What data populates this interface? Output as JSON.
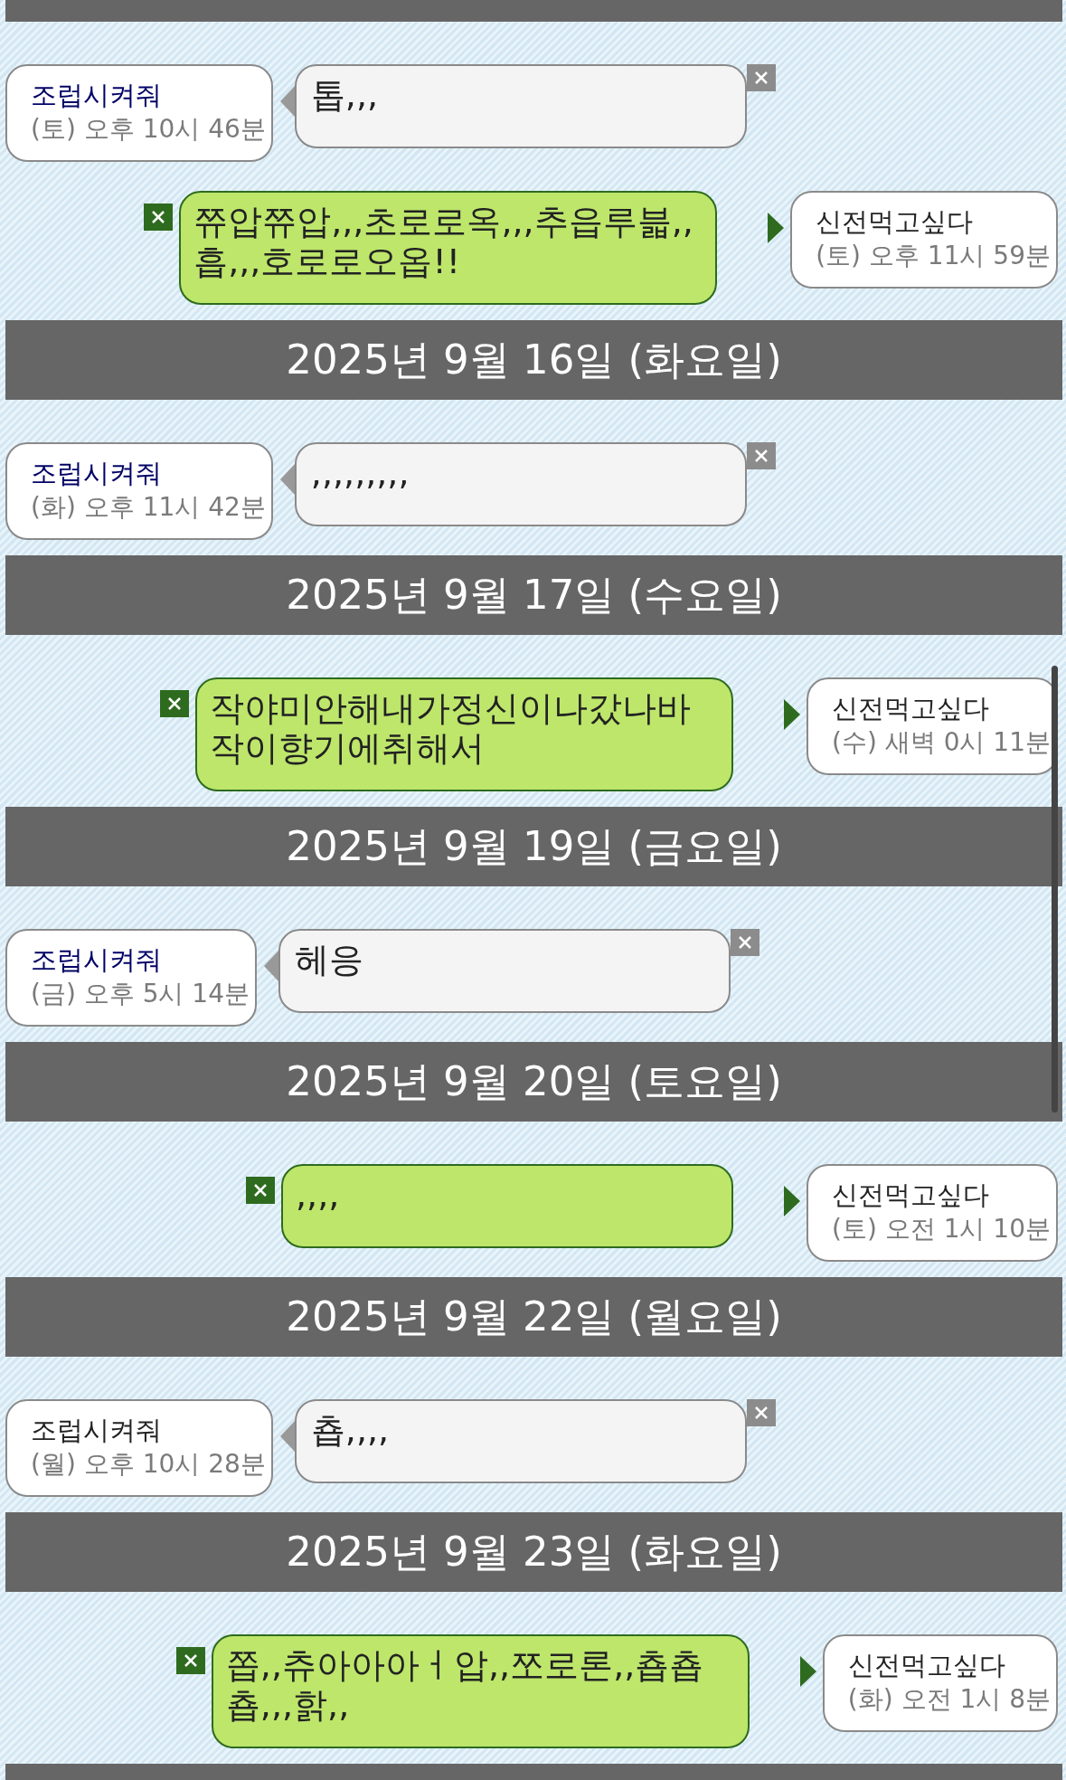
{
  "days": [
    {
      "messages": [
        {
          "kind": "received",
          "sender": {
            "name": "조럽시켜줘",
            "color": "#000066"
          },
          "time": "(토) 오후 10시 46분",
          "text": "톱,,,"
        },
        {
          "kind": "sent",
          "sender": {
            "name": "신전먹고싶다",
            "color": "#222222"
          },
          "time": "(토) 오후 11시 59분",
          "text": "쮸압쮸압,,,초로로옥,,,추읍루븗,,흡,,,호로로오옵!!"
        }
      ]
    },
    {
      "date": "2025년 9월 16일 (화요일)",
      "messages": [
        {
          "kind": "received",
          "sender": {
            "name": "조럽시켜줘",
            "color": "#000066"
          },
          "time": "(화) 오후 11시 42분",
          "text": ",,,,,,,,,"
        }
      ]
    },
    {
      "date": "2025년 9월 17일 (수요일)",
      "messages": [
        {
          "kind": "sent",
          "sender": {
            "name": "신전먹고싶다",
            "color": "#222222"
          },
          "time": "(수) 새벽 0시 11분",
          "text": "작야미안해내가정신이나갔나바작이향기에취해서"
        }
      ]
    },
    {
      "date": "2025년 9월 19일 (금요일)",
      "messages": [
        {
          "kind": "received",
          "sender": {
            "name": "조럽시켜줘",
            "color": "#000066"
          },
          "time": "(금) 오후 5시 14분",
          "text": "헤응"
        }
      ]
    },
    {
      "date": "2025년 9월 20일 (토요일)",
      "messages": [
        {
          "kind": "sent",
          "sender": {
            "name": "신전먹고싶다",
            "color": "#222222"
          },
          "time": "(토) 오전 1시 10분",
          "text": ",,,,"
        }
      ]
    },
    {
      "date": "2025년 9월 22일 (월요일)",
      "messages": [
        {
          "kind": "received",
          "sender": {
            "name": "조럽시켜줘",
            "color": "#222222"
          },
          "time": "(월) 오후 10시 28분",
          "text": "춉,,,,"
        }
      ]
    },
    {
      "date": "2025년 9월 23일 (화요일)",
      "messages": [
        {
          "kind": "sent",
          "sender": {
            "name": "신전먹고싶다",
            "color": "#222222"
          },
          "time": "(화) 오전 1시 8분",
          "text": "쫍,,츄아아아ㅓ압,,쪼로론,,춉춉춉,,,핡,,"
        }
      ]
    }
  ]
}
